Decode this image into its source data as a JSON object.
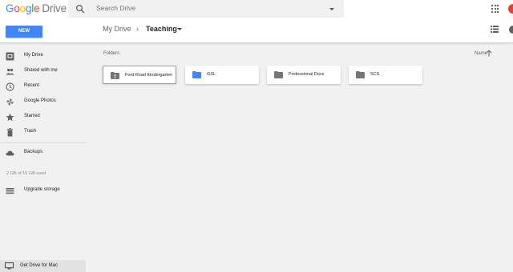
{
  "header": {
    "logo_text": "Google",
    "logo_product": "Drive",
    "search_placeholder": "Search Drive"
  },
  "toolbar": {
    "new_label": "NEW",
    "breadcrumb_root": "My Drive",
    "breadcrumb_separator": "›",
    "breadcrumb_current": "Teaching"
  },
  "sidebar": {
    "items": [
      {
        "label": "My Drive",
        "icon": "my-drive-icon"
      },
      {
        "label": "Shared with me",
        "icon": "people-icon"
      },
      {
        "label": "Recent",
        "icon": "clock-icon"
      },
      {
        "label": "Google Photos",
        "icon": "pinwheel-icon"
      },
      {
        "label": "Starred",
        "icon": "star-icon"
      },
      {
        "label": "Trash",
        "icon": "trash-icon"
      },
      {
        "label": "Backups",
        "icon": "cloud-icon"
      }
    ],
    "storage_text": "2 GB of 15 GB used",
    "upgrade_label": "Upgrade storage",
    "get_drive_label": "Get Drive for Mac"
  },
  "main": {
    "folders_heading": "Folders",
    "sort_label": "Name",
    "folders": [
      {
        "name": "Ford Road Kindergarten",
        "type": "shared",
        "color": "#757575"
      },
      {
        "name": "GSL",
        "type": "folder",
        "color": "#4285f4"
      },
      {
        "name": "Professional Docs",
        "type": "folder",
        "color": "#757575"
      },
      {
        "name": "SCS",
        "type": "folder",
        "color": "#757575"
      }
    ]
  },
  "colors": {
    "accent": "#4285f4",
    "background": "#f1f1f1",
    "notification": "#db4437"
  }
}
